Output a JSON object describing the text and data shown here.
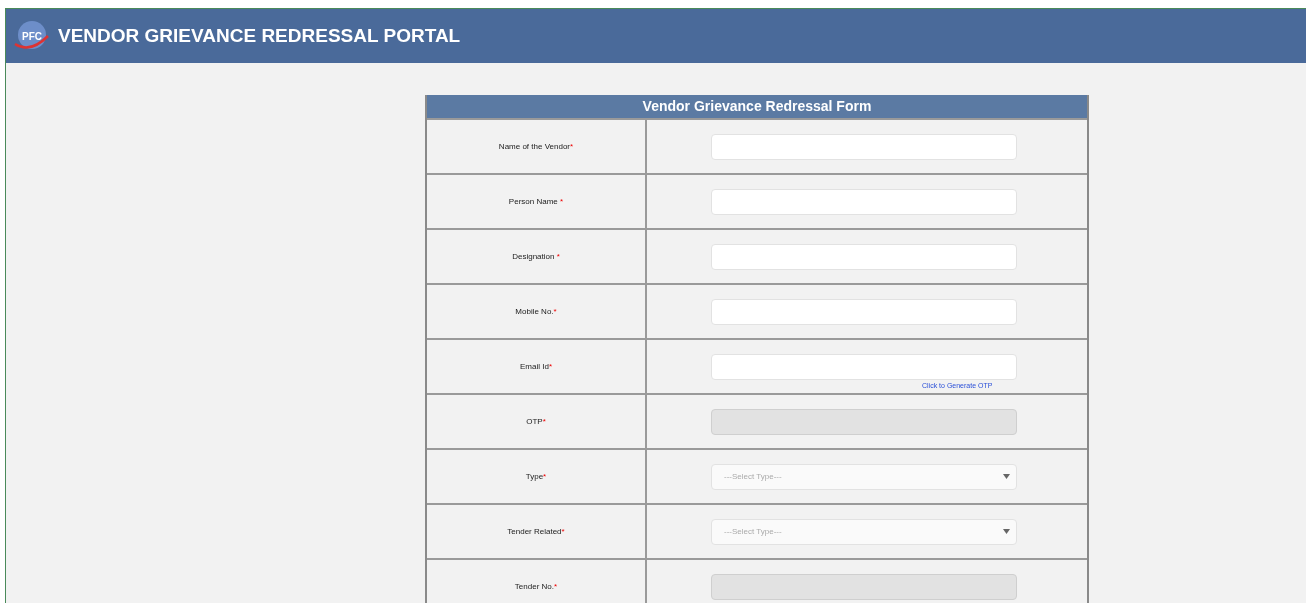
{
  "header": {
    "logo_text": "PFC",
    "title": "VENDOR GRIEVANCE REDRESSAL PORTAL"
  },
  "form": {
    "title": "Vendor Grievance Redressal Form",
    "fields": [
      {
        "label": "Name of the Vendor",
        "required_mark": "*",
        "kind": "text",
        "disabled": false
      },
      {
        "label": "Person Name ",
        "required_mark": "*",
        "kind": "text",
        "disabled": false
      },
      {
        "label": "Designation ",
        "required_mark": "*",
        "kind": "text",
        "disabled": false
      },
      {
        "label": "Mobile No.",
        "required_mark": "*",
        "kind": "text",
        "disabled": false
      },
      {
        "label": "Email Id",
        "required_mark": "*",
        "kind": "text",
        "disabled": false,
        "link": "Click to Generate OTP"
      },
      {
        "label": "OTP",
        "required_mark": "*",
        "kind": "text",
        "disabled": true
      },
      {
        "label": "Type",
        "required_mark": "*",
        "kind": "select",
        "disabled": false,
        "placeholder": "---Select Type---"
      },
      {
        "label": "Tender Related",
        "required_mark": "*",
        "kind": "select",
        "disabled": false,
        "placeholder": "---Select Type---"
      },
      {
        "label": "Tender No.",
        "required_mark": "*",
        "kind": "text",
        "disabled": true
      }
    ]
  }
}
